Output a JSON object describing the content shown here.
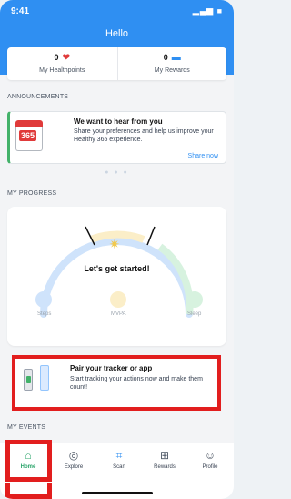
{
  "status_bar": {
    "time": "9:41",
    "icons": "▂▄▆ ■"
  },
  "header": {
    "title": "Hello"
  },
  "stats": {
    "healthpoints": {
      "value": "0",
      "icon": "heart-icon",
      "label": "My Healthpoints"
    },
    "rewards": {
      "value": "0",
      "icon": "ticket-icon",
      "label": "My Rewards"
    }
  },
  "announcements": {
    "section_title": "ANNOUNCEMENTS",
    "calendar_number": "365",
    "title": "We want to hear from you",
    "text": "Share your preferences and help us improve your Healthy 365 experience.",
    "link": "Share now"
  },
  "progress": {
    "section_title": "MY PROGRESS",
    "headline": "Let's get started!",
    "metrics": [
      "Steps",
      "MVPA",
      "Sleep"
    ]
  },
  "tracker": {
    "title": "Pair your tracker or app",
    "text": "Start tracking your actions now and make them count!"
  },
  "events": {
    "section_title": "MY EVENTS"
  },
  "tabs": [
    {
      "label": "Home",
      "icon": "home-icon"
    },
    {
      "label": "Explore",
      "icon": "compass-icon"
    },
    {
      "label": "Scan",
      "icon": "scan-icon"
    },
    {
      "label": "Rewards",
      "icon": "gift-icon"
    },
    {
      "label": "Profile",
      "icon": "profile-icon"
    }
  ],
  "colors": {
    "brand_blue": "#2f8ff2",
    "accent_green": "#2aa46a",
    "highlight_red": "#e21e1e"
  }
}
